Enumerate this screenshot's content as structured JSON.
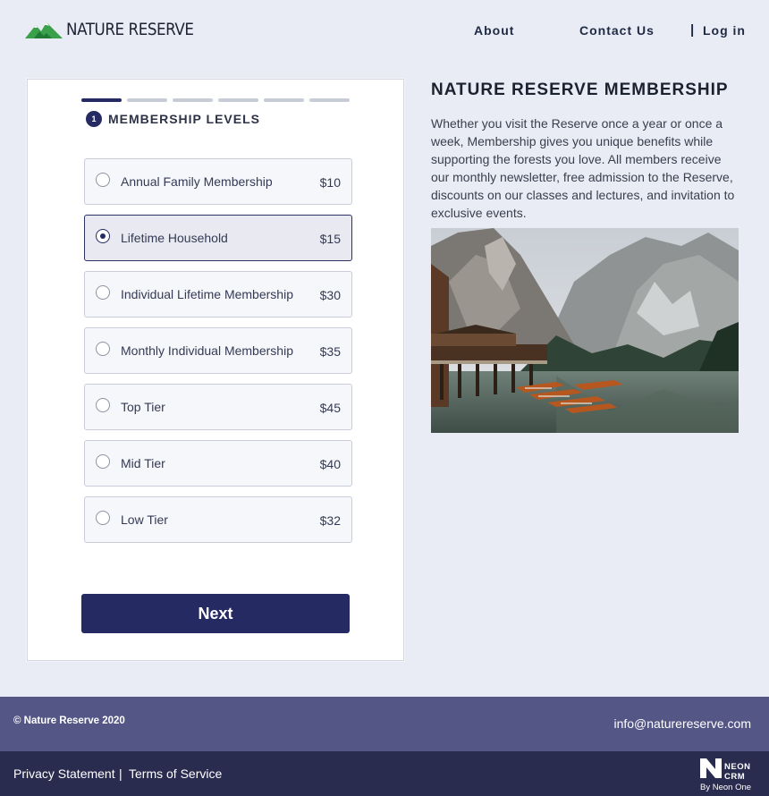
{
  "header": {
    "logo_text": "NATURE RESERVE",
    "nav": {
      "about": "About",
      "contact": "Contact Us",
      "separator": "|",
      "login": "Log in"
    }
  },
  "form": {
    "progress": {
      "total_steps": 6,
      "current_step": 1
    },
    "step_number": "1",
    "step_title": "MEMBERSHIP LEVELS",
    "options": [
      {
        "name": "Annual Family Membership",
        "price": "$10",
        "selected": false
      },
      {
        "name": "Lifetime Household",
        "price": "$15",
        "selected": true
      },
      {
        "name": "Individual Lifetime Membership",
        "price": "$30",
        "selected": false
      },
      {
        "name": "Monthly Individual Membership",
        "price": "$35",
        "selected": false
      },
      {
        "name": "Top Tier",
        "price": "$45",
        "selected": false
      },
      {
        "name": "Mid Tier",
        "price": "$40",
        "selected": false
      },
      {
        "name": "Low Tier",
        "price": "$32",
        "selected": false
      }
    ],
    "next_label": "Next"
  },
  "info": {
    "title": "NATURE RESERVE MEMBERSHIP",
    "description": "Whether you visit the Reserve once a year or once a week, Membership gives you unique benefits while supporting the forests you love. All members receive our monthly newsletter, free admission to the Reserve, discounts on our classes and lectures, and invitation to exclusive events."
  },
  "footer": {
    "copyright": "© Nature Reserve 2020",
    "email": "info@naturereserve.com",
    "privacy": "Privacy Statement",
    "separator": "|",
    "terms": "Terms of Service",
    "powered_brand_line1": "NEON",
    "powered_brand_line2": "CRM",
    "powered_by": "By Neon One"
  },
  "colors": {
    "background": "#e9ebf5",
    "primary": "#262a63",
    "footer_top": "#545786",
    "footer_bottom": "#2a2c4f",
    "logo_green": "#3aa04a"
  },
  "icons": [
    "mountain-logo-icon",
    "neon-crm-logo-icon"
  ]
}
